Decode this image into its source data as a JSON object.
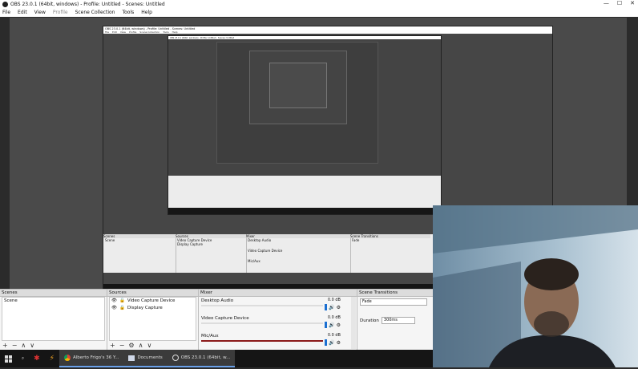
{
  "window": {
    "title": "OBS 23.0.1 (64bit, windows) - Profile: Untitled - Scenes: Untitled",
    "min": "—",
    "max": "☐",
    "close": "✕"
  },
  "menu": [
    "File",
    "Edit",
    "View",
    "Profile",
    "Scene Collection",
    "Tools",
    "Help"
  ],
  "nested_title": "OBS 23.0.1 (64bit, windows) - Profile: Untitled - Scenes: Untitled",
  "dock": {
    "scenes": {
      "title": "Scenes",
      "items": [
        "Scene"
      ]
    },
    "sources": {
      "title": "Sources",
      "items": [
        "Video Capture Device",
        "Display Capture"
      ]
    },
    "mixer": {
      "title": "Mixer",
      "channels": [
        {
          "name": "Desktop Audio",
          "db": "0.0 dB"
        },
        {
          "name": "Video Capture Device",
          "db": "0.0 dB"
        },
        {
          "name": "Mic/Aux",
          "db": "0.0 dB"
        }
      ]
    },
    "transitions": {
      "title": "Scene Transitions",
      "type": "Fade",
      "duration_label": "Duration",
      "duration_value": "300ms"
    }
  },
  "taskbar": {
    "items": [
      {
        "label": "Alberto Frigo's 36 Y..."
      },
      {
        "label": "Documents"
      },
      {
        "label": "OBS 23.0.1 (64bit, w..."
      }
    ]
  }
}
